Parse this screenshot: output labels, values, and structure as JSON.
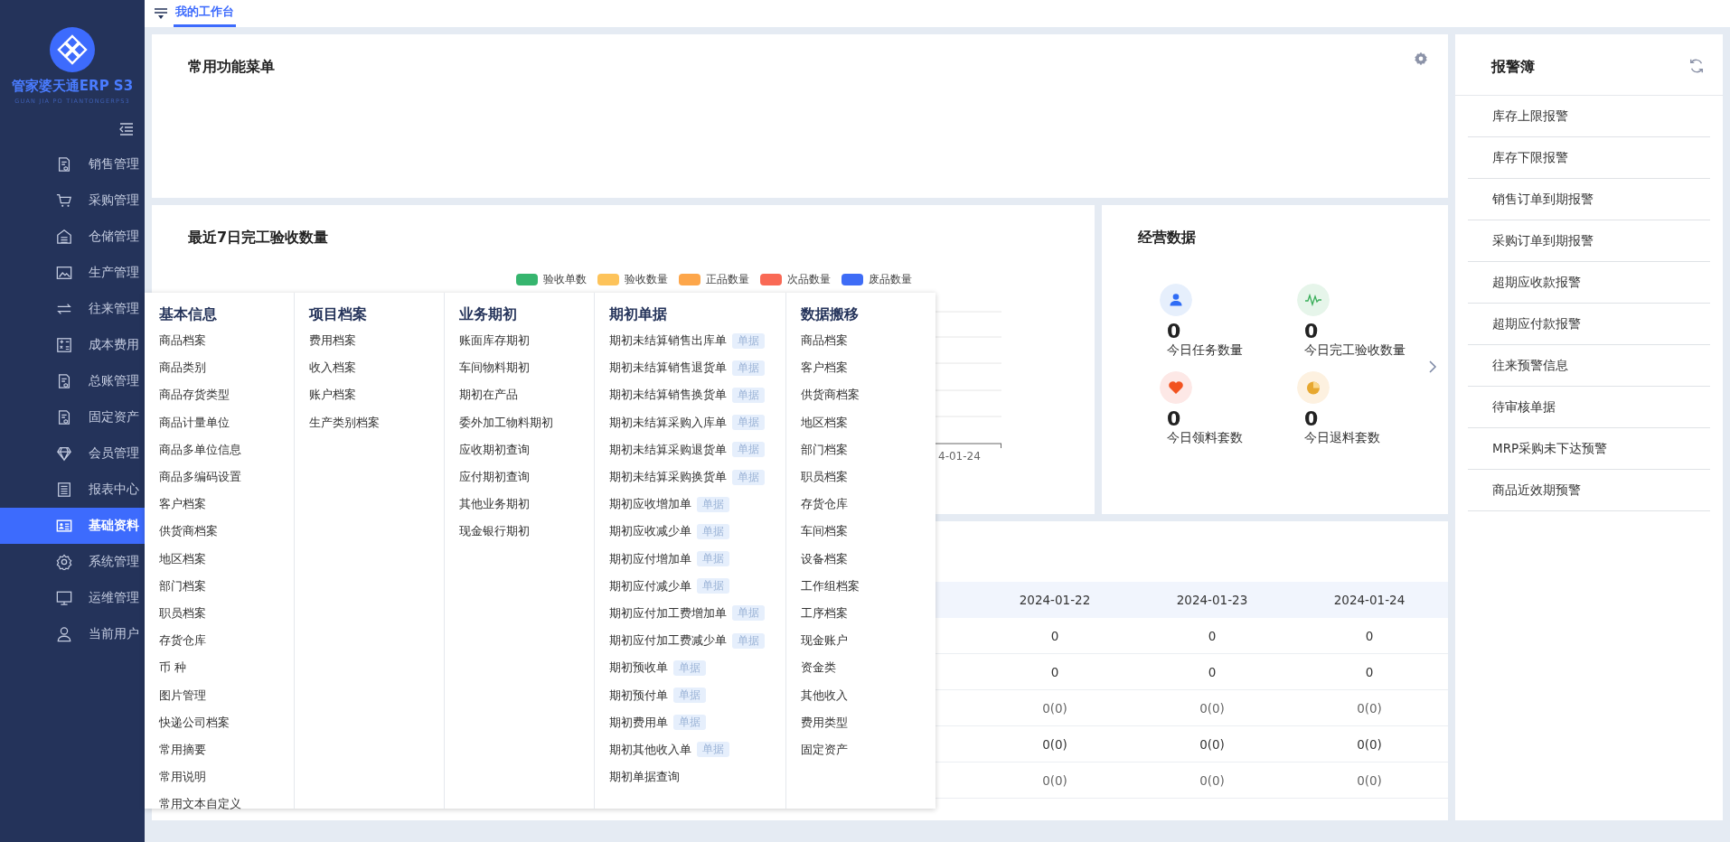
{
  "sidebar": {
    "logo_title": "管家婆天通ERP S3",
    "logo_subtitle": "GUAN JIA PO TIANTONGERPS3",
    "items": [
      {
        "label": "销售管理",
        "selected": false
      },
      {
        "label": "采购管理",
        "selected": false
      },
      {
        "label": "仓储管理",
        "selected": false
      },
      {
        "label": "生产管理",
        "selected": false
      },
      {
        "label": "往来管理",
        "selected": false
      },
      {
        "label": "成本费用",
        "selected": false
      },
      {
        "label": "总账管理",
        "selected": false
      },
      {
        "label": "固定资产",
        "selected": false
      },
      {
        "label": "会员管理",
        "selected": false
      },
      {
        "label": "报表中心",
        "selected": false
      },
      {
        "label": "基础资料",
        "selected": true
      },
      {
        "label": "系统管理",
        "selected": false
      },
      {
        "label": "运维管理",
        "selected": false
      },
      {
        "label": "当前用户",
        "selected": false
      }
    ]
  },
  "tabs": [
    {
      "label": "我的工作台",
      "selected": true
    }
  ],
  "common_menu": {
    "title": "常用功能菜单"
  },
  "chart_panel": {
    "title": "最近7日完工验收数量",
    "legend": [
      {
        "label": "验收单数",
        "color": "#36b56e"
      },
      {
        "label": "验收数量",
        "color": "#fdc35a"
      },
      {
        "label": "正品数量",
        "color": "#fda64a"
      },
      {
        "label": "次品数量",
        "color": "#f96955"
      },
      {
        "label": "废品数量",
        "color": "#3e6cf6"
      }
    ],
    "axis_label": "4-01-24"
  },
  "business_data": {
    "title": "经营数据",
    "stats": [
      {
        "value": "0",
        "label": "今日任务数量"
      },
      {
        "value": "0",
        "label": "今日完工验收数量"
      },
      {
        "value": "0",
        "label": "今日领料套数"
      },
      {
        "value": "0",
        "label": "今日退料套数"
      }
    ]
  },
  "table": {
    "columns": [
      "2024-01-22",
      "2024-01-23",
      "2024-01-24"
    ],
    "rows": [
      [
        "0",
        "0",
        "0"
      ],
      [
        "0",
        "0",
        "0"
      ],
      [
        "0(0)",
        "0(0)",
        "0(0)"
      ],
      [
        "0(0)",
        "0(0)",
        "0(0)"
      ],
      [
        "0(0)",
        "0(0)",
        "0(0)"
      ]
    ]
  },
  "alarm_book": {
    "title": "报警簿",
    "items": [
      "库存上限报警",
      "库存下限报警",
      "销售订单到期报警",
      "采购订单到期报警",
      "超期应收款报警",
      "超期应付款报警",
      "往来预警信息",
      "待审核单据",
      "MRP采购未下达预警",
      "商品近效期预警"
    ]
  },
  "mega_menu": {
    "columns": [
      {
        "title": "基本信息",
        "items": [
          {
            "label": "商品档案"
          },
          {
            "label": "商品类别"
          },
          {
            "label": "商品存货类型"
          },
          {
            "label": "商品计量单位"
          },
          {
            "label": "商品多单位信息"
          },
          {
            "label": "商品多编码设置"
          },
          {
            "label": "客户档案"
          },
          {
            "label": "供货商档案"
          },
          {
            "label": "地区档案"
          },
          {
            "label": "部门档案"
          },
          {
            "label": "职员档案"
          },
          {
            "label": "存货仓库"
          },
          {
            "label": "币 种"
          },
          {
            "label": "图片管理"
          },
          {
            "label": "快递公司档案"
          },
          {
            "label": "常用摘要"
          },
          {
            "label": "常用说明"
          },
          {
            "label": "常用文本自定义"
          }
        ]
      },
      {
        "title": "项目档案",
        "items": [
          {
            "label": "费用档案"
          },
          {
            "label": "收入档案"
          },
          {
            "label": "账户档案"
          },
          {
            "label": "生产类别档案"
          }
        ]
      },
      {
        "title": "业务期初",
        "items": [
          {
            "label": "账面库存期初"
          },
          {
            "label": "车间物料期初"
          },
          {
            "label": "期初在产品"
          },
          {
            "label": "委外加工物料期初"
          },
          {
            "label": "应收期初查询"
          },
          {
            "label": "应付期初查询"
          },
          {
            "label": "其他业务期初"
          },
          {
            "label": "现金银行期初"
          }
        ]
      },
      {
        "title": "期初单据",
        "items": [
          {
            "label": "期初未结算销售出库单",
            "badge": "单据"
          },
          {
            "label": "期初未结算销售退货单",
            "badge": "单据"
          },
          {
            "label": "期初未结算销售换货单",
            "badge": "单据"
          },
          {
            "label": "期初未结算采购入库单",
            "badge": "单据"
          },
          {
            "label": "期初未结算采购退货单",
            "badge": "单据"
          },
          {
            "label": "期初未结算采购换货单",
            "badge": "单据"
          },
          {
            "label": "期初应收增加单",
            "badge": "单据"
          },
          {
            "label": "期初应收减少单",
            "badge": "单据"
          },
          {
            "label": "期初应付增加单",
            "badge": "单据"
          },
          {
            "label": "期初应付减少单",
            "badge": "单据"
          },
          {
            "label": "期初应付加工费增加单",
            "badge": "单据"
          },
          {
            "label": "期初应付加工费减少单",
            "badge": "单据"
          },
          {
            "label": "期初预收单",
            "badge": "单据"
          },
          {
            "label": "期初预付单",
            "badge": "单据"
          },
          {
            "label": "期初费用单",
            "badge": "单据"
          },
          {
            "label": "期初其他收入单",
            "badge": "单据"
          },
          {
            "label": "期初单据查询"
          }
        ]
      },
      {
        "title": "数据搬移",
        "items": [
          {
            "label": "商品档案"
          },
          {
            "label": "客户档案"
          },
          {
            "label": "供货商档案"
          },
          {
            "label": "地区档案"
          },
          {
            "label": "部门档案"
          },
          {
            "label": "职员档案"
          },
          {
            "label": "存货仓库"
          },
          {
            "label": "车间档案"
          },
          {
            "label": "设备档案"
          },
          {
            "label": "工作组档案"
          },
          {
            "label": "工序档案"
          },
          {
            "label": "现金账户"
          },
          {
            "label": "资金类"
          },
          {
            "label": "其他收入"
          },
          {
            "label": "费用类型"
          },
          {
            "label": "固定资产"
          }
        ]
      }
    ]
  }
}
